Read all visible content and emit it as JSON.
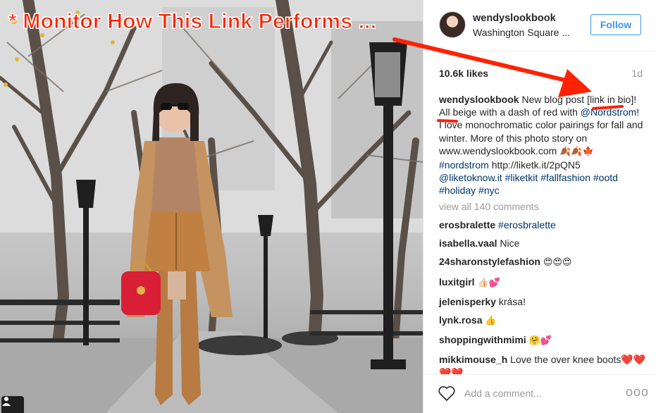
{
  "annotation": {
    "title": "* Monitor How This Link Performs ..."
  },
  "post": {
    "username": "wendyslookbook",
    "location": "Washington Square ...",
    "follow_label": "Follow",
    "likes": "10.6k likes",
    "time_ago": "1d"
  },
  "caption": {
    "username": "wendyslookbook",
    "part1": "New blog post [",
    "link_in_bio": "link in bio",
    "part2": "]! All beige with a dash of red with",
    "mention_nordstrom": "@Nordstrom",
    "part3": "! I love monochromatic color pairings for fall and winter. More of this photo story on www.wendyslookbook.com",
    "emoji_line": "🍂🍂🍁",
    "hashtag_nordstrom": "#nordstrom",
    "liketk_url": "http://liketk.it/2pQN5",
    "mention_liketoknow": "@liketoknow.it",
    "hashtag_liketkit": "#liketkit",
    "hashtag_fallfashion": "#fallfashion",
    "hashtag_ootd": "#ootd",
    "hashtag_holiday": "#holiday",
    "hashtag_nyc": "#nyc"
  },
  "comments": {
    "view_all": "view all 140 comments",
    "items": [
      {
        "user": "erosbralette",
        "text": "#erosbralette",
        "is_tag": true
      },
      {
        "user": "isabella.vaal",
        "text": "Nice",
        "is_tag": false
      },
      {
        "user": "24sharonstylefashion",
        "text": "😍😍😍",
        "is_tag": false
      },
      {
        "user": "luxitgirl",
        "text": "👍🏻💕",
        "is_tag": false
      },
      {
        "user": "jelenisperky",
        "text": "krása!",
        "is_tag": false
      },
      {
        "user": "lynk.rosa",
        "text": "👍",
        "is_tag": false
      },
      {
        "user": "shoppingwithmimi",
        "text": "🤗💕",
        "is_tag": false
      },
      {
        "user": "mikkimouse_h",
        "text": "Love the over knee boots❤️❤️❤️❤️",
        "is_tag": false
      }
    ]
  },
  "footer": {
    "add_comment_placeholder": "Add a comment...",
    "more_label": "ooo"
  },
  "icons": {
    "like": "heart-icon",
    "more": "more-options-icon",
    "user_tag": "person-icon"
  },
  "colors": {
    "annotation_red": "#ff2200",
    "link_blue": "#003569",
    "follow_blue": "#3897f0"
  }
}
